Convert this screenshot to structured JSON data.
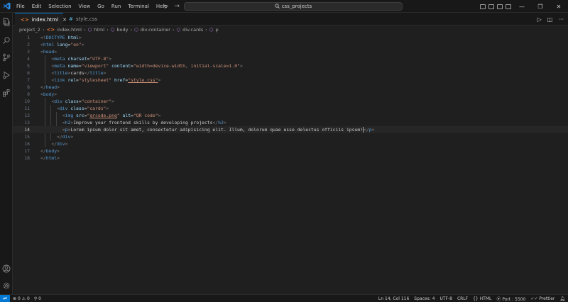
{
  "menu": [
    "File",
    "Edit",
    "Selection",
    "View",
    "Go",
    "Run",
    "Terminal",
    "Help"
  ],
  "search": {
    "text": "css_projects"
  },
  "tabs": [
    {
      "label": "index.html",
      "icon": "html-file-icon",
      "active": true
    },
    {
      "label": "style.css",
      "icon": "css-file-icon",
      "active": false
    }
  ],
  "breadcrumb": {
    "folder": "project_2",
    "file": "index.html",
    "items": [
      "html",
      "body",
      "div.container",
      "div.cards",
      "p"
    ]
  },
  "code": {
    "line_numbers": [
      "1",
      "2",
      "3",
      "4",
      "5",
      "6",
      "7",
      "8",
      "9",
      "10",
      "11",
      "12",
      "13",
      "14",
      "15",
      "16",
      "17",
      "18"
    ],
    "current_line": 14
  },
  "status": {
    "errors": "0",
    "warnings": "0",
    "ports": "0",
    "position": "Ln 14, Col 116",
    "spaces": "Spaces: 4",
    "encoding": "UTF-8",
    "eol": "CRLF",
    "language": "HTML",
    "port": "Port : 5500",
    "formatter": "Prettier"
  },
  "colors": {
    "accent": "#0078d4",
    "tag": "#569cd6",
    "attribute": "#9cdcfe",
    "string": "#ce9178",
    "background": "#1f1f1f"
  }
}
